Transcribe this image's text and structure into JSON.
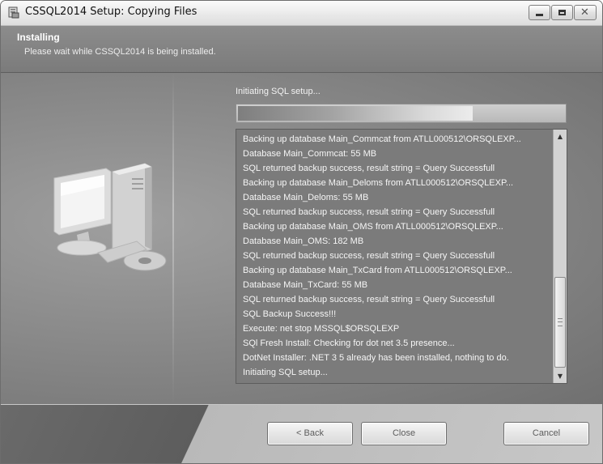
{
  "window": {
    "title": "CSSQL2014 Setup: Copying Files",
    "app_icon": "installer-icon",
    "controls": {
      "minimize_icon": "minimize-icon",
      "maximize_icon": "maximize-icon",
      "close_icon": "close-icon",
      "close_glyph": "✕"
    }
  },
  "header": {
    "title": "Installing",
    "subtitle": "Please wait while CSSQL2014 is being installed."
  },
  "main": {
    "illustration_icon": "computer-install-icon",
    "status_text": "Initiating SQL setup...",
    "progress": {
      "value": 0.72
    },
    "log": {
      "lines": [
        "Backing up database Main_Commcat from ATLL000512\\ORSQLEXP...",
        "Database Main_Commcat: 55 MB",
        "SQL returned backup success, result string = Query Successfull",
        "Backing up database Main_Deloms from ATLL000512\\ORSQLEXP...",
        "Database Main_Deloms: 55 MB",
        "SQL returned backup success, result string = Query Successfull",
        "Backing up database Main_OMS from ATLL000512\\ORSQLEXP...",
        "Database Main_OMS: 182 MB",
        "SQL returned backup success, result string = Query Successfull",
        "Backing up database Main_TxCard from ATLL000512\\ORSQLEXP...",
        "Database Main_TxCard: 55 MB",
        "SQL returned backup success, result string = Query Successfull",
        "SQL Backup Success!!!",
        "Execute: net stop MSSQL$ORSQLEXP",
        "SQl Fresh Install: Checking for dot net 3.5 presence...",
        "DotNet Installer: .NET 3 5 already has been installed, nothing to do.",
        "Initiating SQL setup..."
      ],
      "scroll_up_glyph": "▲",
      "scroll_down_glyph": "▼"
    }
  },
  "footer": {
    "back_label": "< Back",
    "close_label": "Close",
    "cancel_label": "Cancel"
  },
  "colors": {
    "header_bg": "#858585",
    "main_bg": "#8a8a8a",
    "log_bg": "#7b7b7b",
    "text_light": "#f5f5f5"
  }
}
